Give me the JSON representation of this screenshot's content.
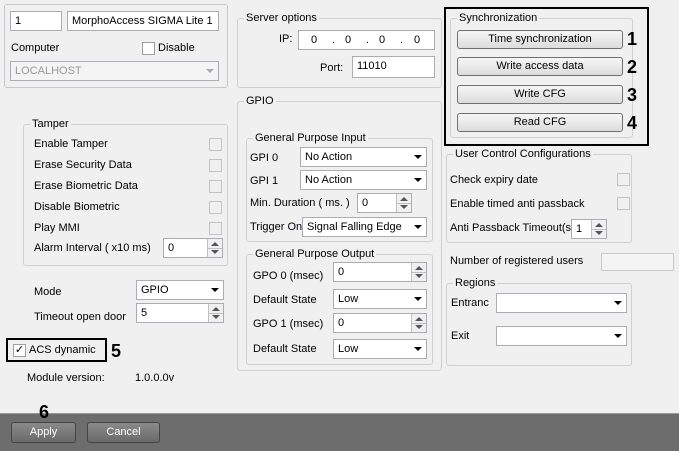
{
  "device": {
    "id": "1",
    "name": "MorphoAccess SIGMA Lite 1",
    "computer_label": "Computer",
    "disable_label": "Disable",
    "computer_value": "LOCALHOST"
  },
  "tamper": {
    "title": "Tamper",
    "options": [
      {
        "label": "Enable Tamper"
      },
      {
        "label": "Erase Security Data"
      },
      {
        "label": "Erase Biometric Data"
      },
      {
        "label": "Disable Biometric"
      },
      {
        "label": "Play MMI"
      }
    ],
    "alarm_interval_label": "Alarm Interval ( x10 ms)",
    "alarm_interval_value": "0"
  },
  "mode": {
    "label": "Mode",
    "value": "GPIO",
    "timeout_label": "Timeout open door",
    "timeout_value": "5"
  },
  "acs_dynamic": {
    "label": "ACS dynamic",
    "checked_glyph": "✓"
  },
  "module_version": {
    "label": "Module version:",
    "value": "1.0.0.0v"
  },
  "server": {
    "title": "Server options",
    "ip_label": "IP:",
    "ip_octets": [
      "0",
      "0",
      "0",
      "0"
    ],
    "ip_dot": ".",
    "port_label": "Port:",
    "port_value": "11010"
  },
  "gpio": {
    "title": "GPIO",
    "gpi_title": "General Purpose Input",
    "gpi0_label": "GPI 0",
    "gpi0_value": "No Action",
    "gpi1_label": "GPI 1",
    "gpi1_value": "No Action",
    "min_duration_label": "Min. Duration ( ms. )",
    "min_duration_value": "0",
    "trigger_label": "Trigger On",
    "trigger_value": "Signal Falling Edge",
    "gpo_title": "General Purpose Output",
    "gpo0_label": "GPO 0 (msec)",
    "gpo0_value": "0",
    "default_state_label": "Default State",
    "default_state0_value": "Low",
    "gpo1_label": "GPO 1 (msec)",
    "gpo1_value": "0",
    "default_state1_value": "Low"
  },
  "sync": {
    "title": "Synchronization",
    "buttons": [
      "Time synchronization",
      "Write access data",
      "Write CFG",
      "Read CFG"
    ]
  },
  "ucc": {
    "title": "User Control Configurations",
    "check_expiry_label": "Check expiry date",
    "timed_passback_label": "Enable timed anti passback",
    "passback_timeout_label": "Anti Passback Timeout(s)",
    "passback_timeout_value": "1"
  },
  "registered_users_label": "Number of registered users",
  "regions": {
    "title": "Regions",
    "entrance_label": "Entranc",
    "exit_label": "Exit"
  },
  "annotations": [
    "1",
    "2",
    "3",
    "4",
    "5",
    "6"
  ],
  "footer": {
    "apply_label": "Apply",
    "cancel_label": "Cancel"
  }
}
